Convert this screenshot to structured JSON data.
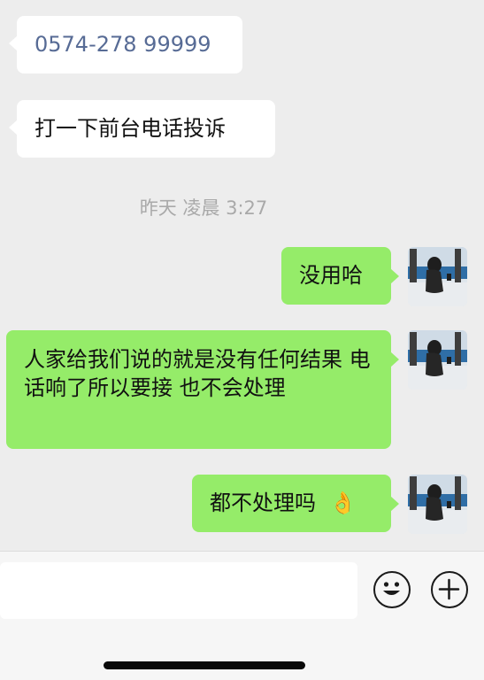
{
  "messages": [
    {
      "side": "left",
      "text": "0574-278 99999"
    },
    {
      "side": "left",
      "text": "打一下前台电话投诉"
    },
    {
      "side": "right",
      "text": "没用哈"
    },
    {
      "side": "right",
      "text": "人家给我们说的就是没有任何结果 电话响了所以要接 也不会处理"
    },
    {
      "side": "right",
      "text": "都不处理吗",
      "emoji": "👌"
    }
  ],
  "timestamp": "昨天 凌晨 3:27",
  "input_bar": {
    "emoji_button_icon": "smiley-face-icon",
    "plus_button_icon": "plus-circle-icon"
  },
  "colors": {
    "background": "#ededed",
    "incoming_bubble": "#ffffff",
    "outgoing_bubble": "#95ec69",
    "phone_link_text": "#576b95",
    "timestamp_text": "#a9a9a9"
  }
}
